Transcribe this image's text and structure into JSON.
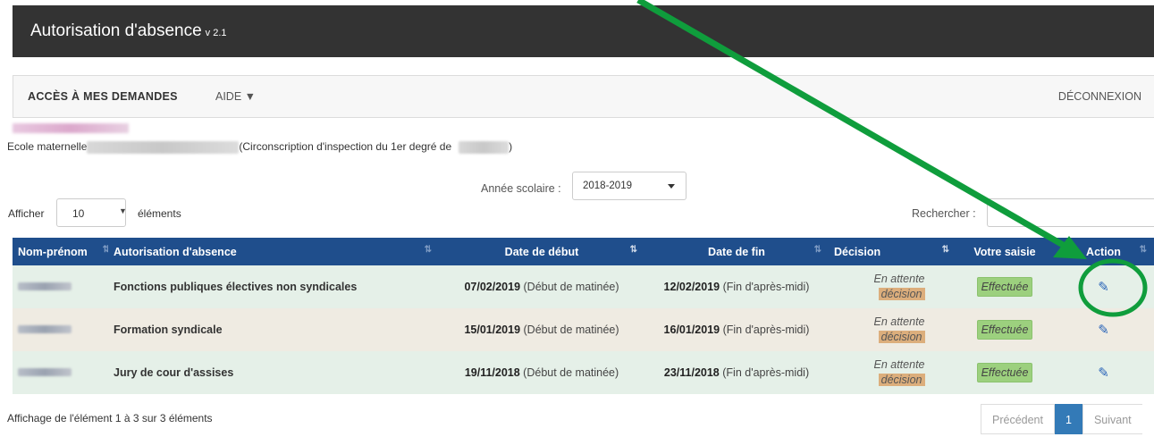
{
  "app": {
    "title": "Autorisation d'absence",
    "version": "v 2.1"
  },
  "nav": {
    "access": "ACCÈS À MES DEMANDES",
    "aide": "AIDE ▼",
    "logout": "DÉCONNEXION"
  },
  "school": {
    "prefix": "Ecole maternelle",
    "circ": "(Circonscription d'inspection du 1er degré de",
    "close": ")"
  },
  "filters": {
    "year_label": "Année scolaire :",
    "year_value": "2018-2019",
    "show_label": "Afficher",
    "page_length": "10",
    "elements_label": "éléments",
    "search_label": "Rechercher :"
  },
  "table": {
    "headers": [
      "Nom-prénom",
      "Autorisation d'absence",
      "Date de début",
      "Date de fin",
      "Décision",
      "Votre saisie",
      "Action"
    ],
    "rows": [
      {
        "type": "Fonctions publiques électives non syndicales",
        "start_date": "07/02/2019",
        "start_note": "(Début de matinée)",
        "end_date": "12/02/2019",
        "end_note": "(Fin d'après-midi)",
        "decision_l1": "En attente",
        "decision_l2": "décision",
        "saisie": "Effectuée"
      },
      {
        "type": "Formation syndicale",
        "start_date": "15/01/2019",
        "start_note": "(Début de matinée)",
        "end_date": "16/01/2019",
        "end_note": "(Fin d'après-midi)",
        "decision_l1": "En attente",
        "decision_l2": "décision",
        "saisie": "Effectuée"
      },
      {
        "type": "Jury de cour d'assises",
        "start_date": "19/11/2018",
        "start_note": "(Début de matinée)",
        "end_date": "23/11/2018",
        "end_note": "(Fin d'après-midi)",
        "decision_l1": "En attente",
        "decision_l2": "décision",
        "saisie": "Effectuée"
      }
    ]
  },
  "footer": {
    "info": "Affichage de l'élément 1 à 3 sur 3 éléments",
    "prev": "Précédent",
    "page": "1",
    "next": "Suivant"
  },
  "colors": {
    "header_bar": "#333333",
    "table_header": "#1f4e8c",
    "arrow": "#0f9d3c",
    "row_green": "#e5f0e8",
    "row_beige": "#efebe2"
  },
  "icons": {
    "edit": "pencil-icon",
    "sort": "sort-icon",
    "select_caret": "caret-down-icon"
  }
}
